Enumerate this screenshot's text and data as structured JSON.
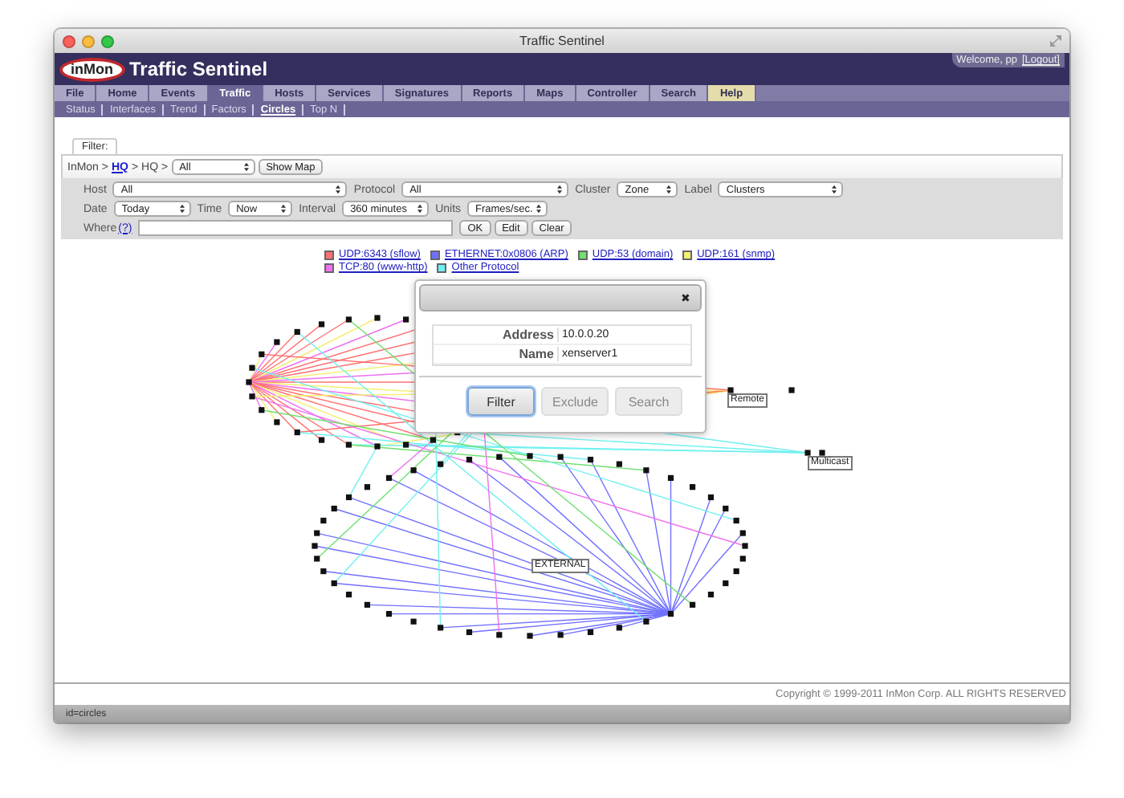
{
  "window": {
    "title": "Traffic Sentinel"
  },
  "header": {
    "logo": "inMon",
    "title": "Traffic Sentinel",
    "welcome": "Welcome, pp",
    "logout": "[Logout]"
  },
  "nav": [
    {
      "label": "File",
      "selected": false,
      "kind": "tab"
    },
    {
      "label": "Home",
      "selected": false,
      "kind": "tab"
    },
    {
      "label": "Events",
      "selected": false,
      "kind": "tab"
    },
    {
      "label": "Traffic",
      "selected": true,
      "kind": "tab"
    },
    {
      "label": "Hosts",
      "selected": false,
      "kind": "tab"
    },
    {
      "label": "Services",
      "selected": false,
      "kind": "tab"
    },
    {
      "label": "Signatures",
      "selected": false,
      "kind": "tab"
    },
    {
      "label": "Reports",
      "selected": false,
      "kind": "tab"
    },
    {
      "label": "Maps",
      "selected": false,
      "kind": "tab"
    },
    {
      "label": "Controller",
      "selected": false,
      "kind": "tab"
    },
    {
      "label": "Search",
      "selected": false,
      "kind": "tab"
    },
    {
      "label": "Help",
      "selected": false,
      "kind": "help"
    }
  ],
  "subnav": [
    {
      "label": "Status",
      "selected": false
    },
    {
      "label": "Interfaces",
      "selected": false
    },
    {
      "label": "Trend",
      "selected": false
    },
    {
      "label": "Factors",
      "selected": false
    },
    {
      "label": "Circles",
      "selected": true
    },
    {
      "label": "Top N",
      "selected": false
    }
  ],
  "filter": {
    "legend": "Filter:",
    "breadcrumb": [
      {
        "text": "InMon >",
        "kind": "text"
      },
      {
        "text": "HQ",
        "kind": "link"
      },
      {
        "text": "> HQ >",
        "kind": "text"
      }
    ],
    "scope_select": "All",
    "show_map": "Show Map",
    "selectors": [
      {
        "label": "Host",
        "value": "All"
      },
      {
        "label": "Protocol",
        "value": "All"
      },
      {
        "label": "Cluster",
        "value": "Zone"
      },
      {
        "label": "Label",
        "value": "Clusters"
      },
      {
        "label": "Date",
        "value": "Today"
      },
      {
        "label": "Time",
        "value": "Now"
      },
      {
        "label": "Interval",
        "value": "360 minutes"
      },
      {
        "label": "Units",
        "value": "Frames/sec."
      }
    ],
    "where": {
      "label": "Where",
      "help": "(?)",
      "buttons": [
        "OK",
        "Edit",
        "Clear"
      ]
    }
  },
  "legend": [
    {
      "label": "UDP:6343 (sflow)",
      "color": "#ff7070"
    },
    {
      "label": "ETHERNET:0x0806 (ARP)",
      "color": "#7070ff"
    },
    {
      "label": "UDP:53 (domain)",
      "color": "#70e070"
    },
    {
      "label": "UDP:161 (snmp)",
      "color": "#f4f070"
    },
    {
      "label": "TCP:80 (www-http)",
      "color": "#f070f0"
    },
    {
      "label": "Other Protocol",
      "color": "#70f0f0"
    }
  ],
  "diagram": {
    "labels": [
      "Remote",
      "Multicast",
      "EXTERNAL"
    ]
  },
  "dialog": {
    "close": "✖",
    "fields": [
      {
        "label": "Address",
        "value": "10.0.0.20"
      },
      {
        "label": "Name",
        "value": "xenserver1"
      }
    ],
    "buttons": [
      {
        "label": "Filter",
        "selected": true
      },
      {
        "label": "Exclude",
        "selected": false
      },
      {
        "label": "Search",
        "selected": false
      }
    ]
  },
  "copyright": "Copyright © 1999-2011 InMon Corp. ALL RIGHTS RESERVED",
  "status_bar": "id=circles"
}
